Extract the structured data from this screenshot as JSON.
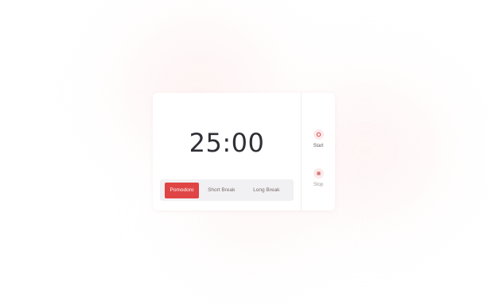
{
  "timer": {
    "display": "25:00"
  },
  "modes": [
    {
      "label": "Pomodoro",
      "active": true
    },
    {
      "label": "Short Break",
      "active": false
    },
    {
      "label": "Long Break",
      "active": false
    }
  ],
  "controls": {
    "start_label": "Start",
    "stop_label": "Stop"
  },
  "colors": {
    "accent": "#e04545",
    "timer_text": "#2f2f35",
    "mode_bar_bg": "#f1f1f3",
    "control_circle_bg": "#fbeaea"
  },
  "icons": {
    "start": "play-circle-icon",
    "stop": "stop-square-icon"
  }
}
